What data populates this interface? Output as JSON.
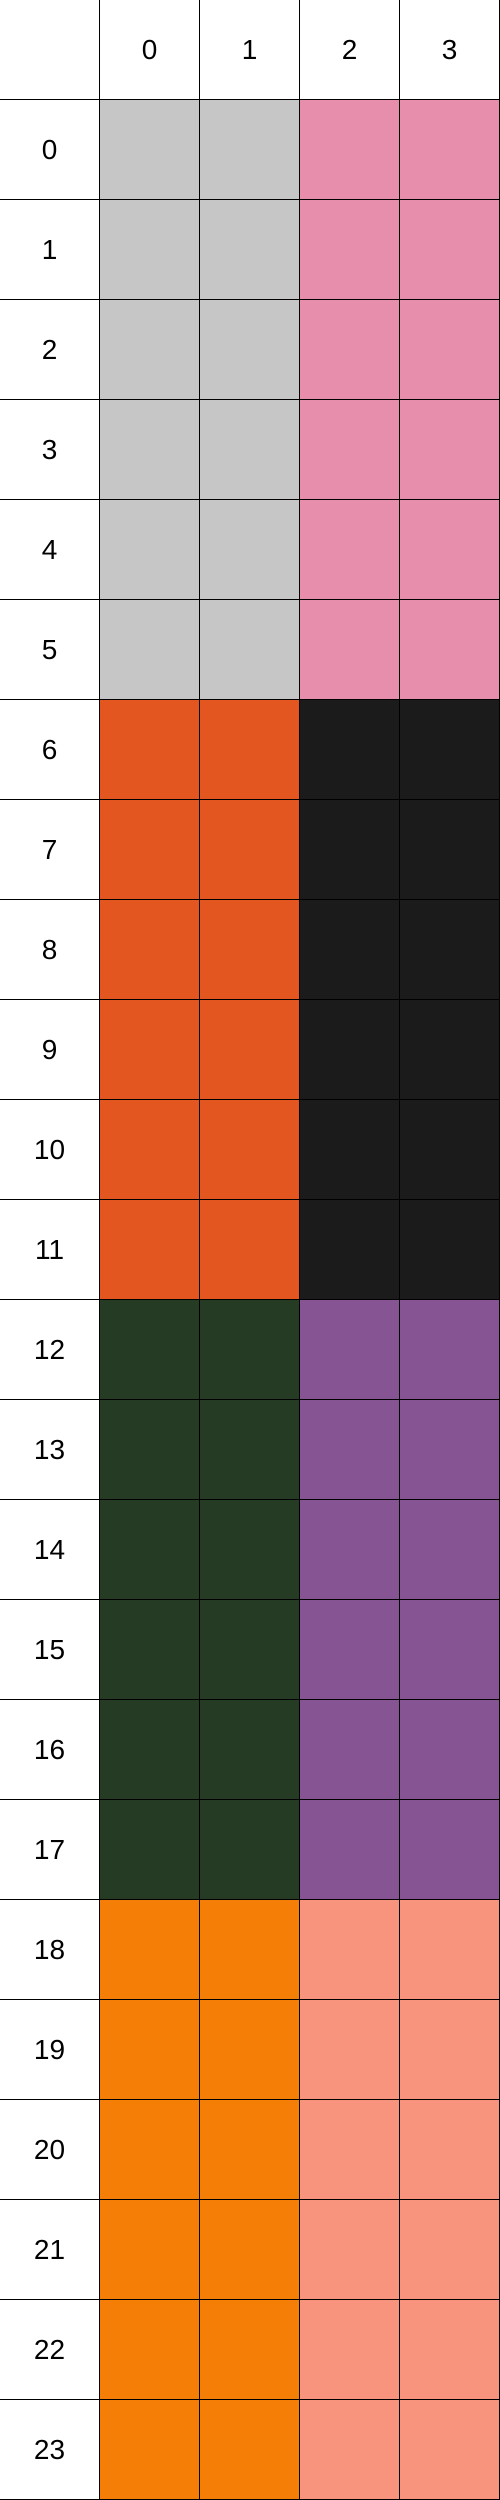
{
  "column_headers": [
    "0",
    "1",
    "2",
    "3"
  ],
  "row_headers": [
    "0",
    "1",
    "2",
    "3",
    "4",
    "5",
    "6",
    "7",
    "8",
    "9",
    "10",
    "11",
    "12",
    "13",
    "14",
    "15",
    "16",
    "17",
    "18",
    "19",
    "20",
    "21",
    "22",
    "23"
  ],
  "colors": {
    "grid_line": "#000000",
    "background": "#ffffff",
    "blocks": [
      {
        "name": "light-gray",
        "hex": "#c6c6c6"
      },
      {
        "name": "pink",
        "hex": "#e68eab"
      },
      {
        "name": "orange-red",
        "hex": "#e45620"
      },
      {
        "name": "black",
        "hex": "#1b1b1b"
      },
      {
        "name": "dark-green",
        "hex": "#263b23"
      },
      {
        "name": "purple",
        "hex": "#865493"
      },
      {
        "name": "orange",
        "hex": "#f57f06"
      },
      {
        "name": "salmon",
        "hex": "#f8937d"
      }
    ]
  },
  "cell_colors": [
    [
      "#c6c6c6",
      "#c6c6c6",
      "#e68eab",
      "#e68eab"
    ],
    [
      "#c6c6c6",
      "#c6c6c6",
      "#e68eab",
      "#e68eab"
    ],
    [
      "#c6c6c6",
      "#c6c6c6",
      "#e68eab",
      "#e68eab"
    ],
    [
      "#c6c6c6",
      "#c6c6c6",
      "#e68eab",
      "#e68eab"
    ],
    [
      "#c6c6c6",
      "#c6c6c6",
      "#e68eab",
      "#e68eab"
    ],
    [
      "#c6c6c6",
      "#c6c6c6",
      "#e68eab",
      "#e68eab"
    ],
    [
      "#e45620",
      "#e45620",
      "#1b1b1b",
      "#1b1b1b"
    ],
    [
      "#e45620",
      "#e45620",
      "#1b1b1b",
      "#1b1b1b"
    ],
    [
      "#e45620",
      "#e45620",
      "#1b1b1b",
      "#1b1b1b"
    ],
    [
      "#e45620",
      "#e45620",
      "#1b1b1b",
      "#1b1b1b"
    ],
    [
      "#e45620",
      "#e45620",
      "#1b1b1b",
      "#1b1b1b"
    ],
    [
      "#e45620",
      "#e45620",
      "#1b1b1b",
      "#1b1b1b"
    ],
    [
      "#263b23",
      "#263b23",
      "#865493",
      "#865493"
    ],
    [
      "#263b23",
      "#263b23",
      "#865493",
      "#865493"
    ],
    [
      "#263b23",
      "#263b23",
      "#865493",
      "#865493"
    ],
    [
      "#263b23",
      "#263b23",
      "#865493",
      "#865493"
    ],
    [
      "#263b23",
      "#263b23",
      "#865493",
      "#865493"
    ],
    [
      "#263b23",
      "#263b23",
      "#865493",
      "#865493"
    ],
    [
      "#f57f06",
      "#f57f06",
      "#f8937d",
      "#f8937d"
    ],
    [
      "#f57f06",
      "#f57f06",
      "#f8937d",
      "#f8937d"
    ],
    [
      "#f57f06",
      "#f57f06",
      "#f8937d",
      "#f8937d"
    ],
    [
      "#f57f06",
      "#f57f06",
      "#f8937d",
      "#f8937d"
    ],
    [
      "#f57f06",
      "#f57f06",
      "#f8937d",
      "#f8937d"
    ],
    [
      "#f57f06",
      "#f57f06",
      "#f8937d",
      "#f8937d"
    ]
  ]
}
